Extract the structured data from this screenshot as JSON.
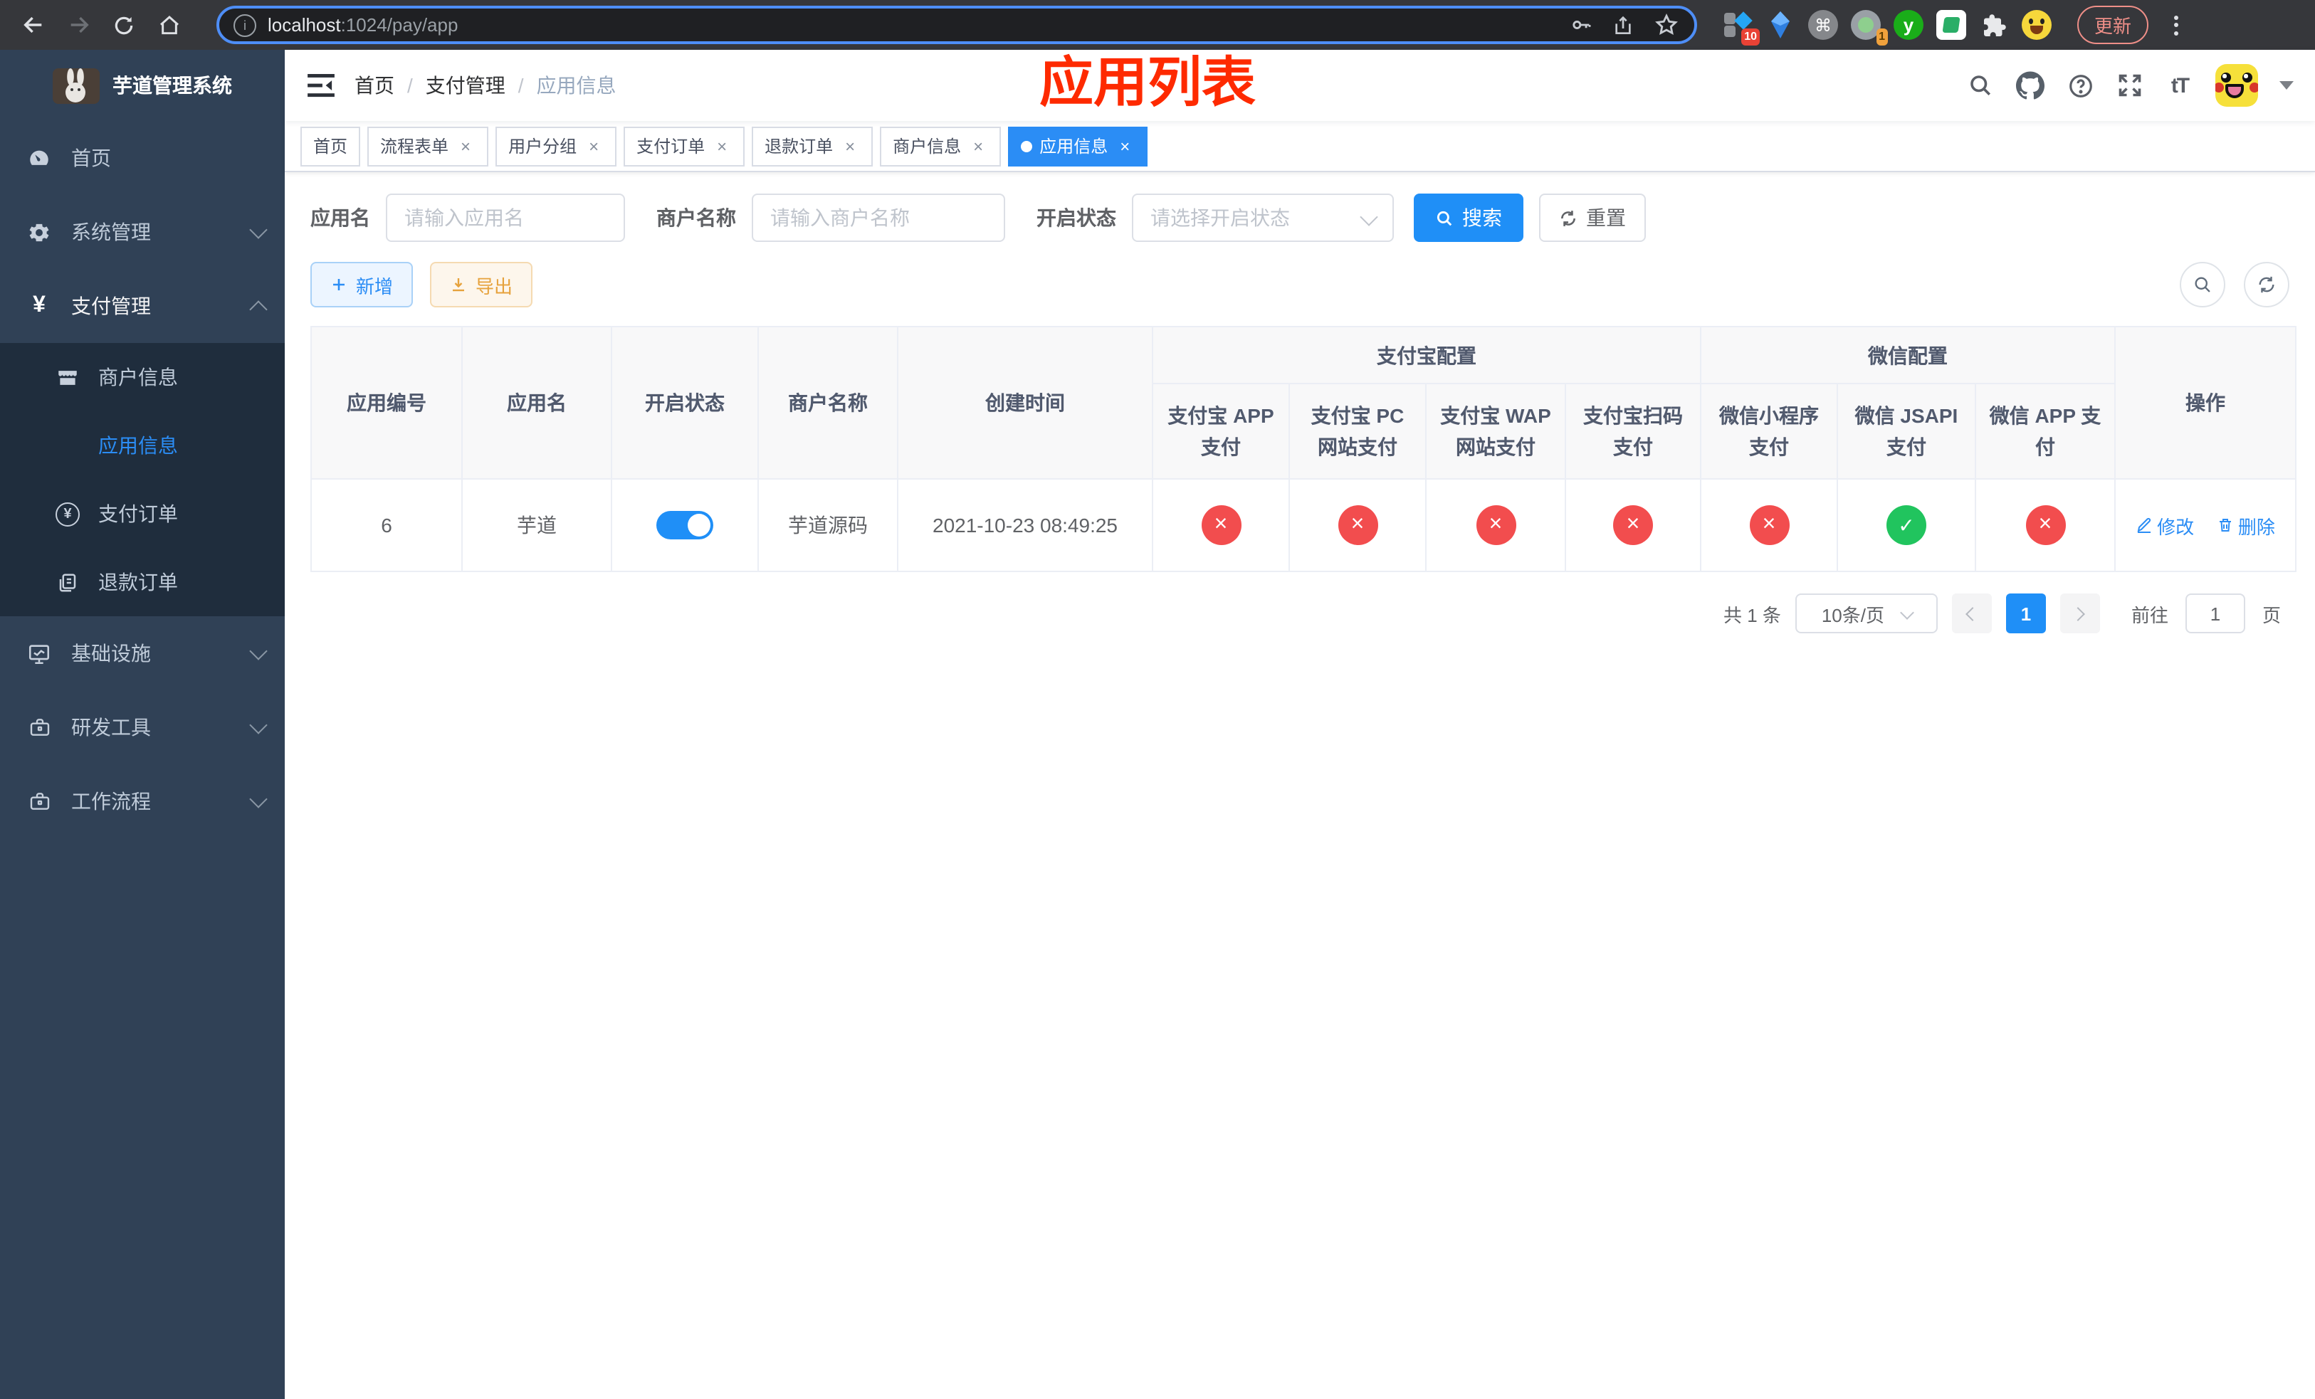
{
  "browser": {
    "url_host": "localhost",
    "url_rest": ":1024/pay/app",
    "update_button": "更新",
    "ext_badge_blue": "10",
    "ext_badge_gray": "1",
    "ext_letter_y": "y"
  },
  "sidebar": {
    "title": "芋道管理系统",
    "items": [
      {
        "label": "首页"
      },
      {
        "label": "系统管理"
      },
      {
        "label": "支付管理"
      },
      {
        "label": "基础设施"
      },
      {
        "label": "研发工具"
      },
      {
        "label": "工作流程"
      }
    ],
    "submenu": [
      {
        "label": "商户信息"
      },
      {
        "label": "应用信息"
      },
      {
        "label": "支付订单"
      },
      {
        "label": "退款订单"
      }
    ]
  },
  "header": {
    "breadcrumb": [
      {
        "label": "首页"
      },
      {
        "label": "支付管理"
      },
      {
        "label": "应用信息"
      }
    ],
    "annotation": "应用列表"
  },
  "tabs": [
    {
      "label": "首页"
    },
    {
      "label": "流程表单"
    },
    {
      "label": "用户分组"
    },
    {
      "label": "支付订单"
    },
    {
      "label": "退款订单"
    },
    {
      "label": "商户信息"
    },
    {
      "label": "应用信息"
    }
  ],
  "filters": {
    "app_name_label": "应用名",
    "app_name_placeholder": "请输入应用名",
    "merchant_label": "商户名称",
    "merchant_placeholder": "请输入商户名称",
    "status_label": "开启状态",
    "status_placeholder": "请选择开启状态",
    "search_button": "搜索",
    "reset_button": "重置"
  },
  "toolbar": {
    "add_button": "新增",
    "export_button": "导出"
  },
  "table": {
    "headers": {
      "app_id": "应用编号",
      "app_name": "应用名",
      "status": "开启状态",
      "merchant": "商户名称",
      "created": "创建时间",
      "group_alipay": "支付宝配置",
      "group_wechat": "微信配置",
      "alipay_app": "支付宝 APP 支付",
      "alipay_pc": "支付宝 PC 网站支付",
      "alipay_wap": "支付宝 WAP 网站支付",
      "alipay_qr": "支付宝扫码支付",
      "wechat_lite": "微信小程序支付",
      "wechat_jsapi": "微信 JSAPI 支付",
      "wechat_app": "微信 APP 支付",
      "ops": "操作"
    },
    "row": {
      "id": "6",
      "name": "芋道",
      "enabled": true,
      "merchant": "芋道源码",
      "created": "2021-10-23 08:49:25",
      "channels": [
        {
          "name": "alipay_app",
          "enabled": false
        },
        {
          "name": "alipay_pc",
          "enabled": false
        },
        {
          "name": "alipay_wap",
          "enabled": false
        },
        {
          "name": "alipay_qr",
          "enabled": false
        },
        {
          "name": "wechat_lite",
          "enabled": false
        },
        {
          "name": "wechat_jsapi",
          "enabled": true
        },
        {
          "name": "wechat_app",
          "enabled": false
        }
      ]
    },
    "actions": {
      "edit": "修改",
      "delete": "删除"
    }
  },
  "pagination": {
    "total": "共 1 条",
    "page_size": "10条/页",
    "current_page": "1",
    "goto_label": "前往",
    "goto_value": "1",
    "goto_suffix": "页"
  },
  "colors": {
    "primary_blue": "#1f8ff7",
    "danger_red": "#f24d4e",
    "success_green": "#21c45e",
    "sidebar_bg": "#304156",
    "submenu_bg": "#1f2d3d",
    "annotation_red": "#fe2a00"
  }
}
